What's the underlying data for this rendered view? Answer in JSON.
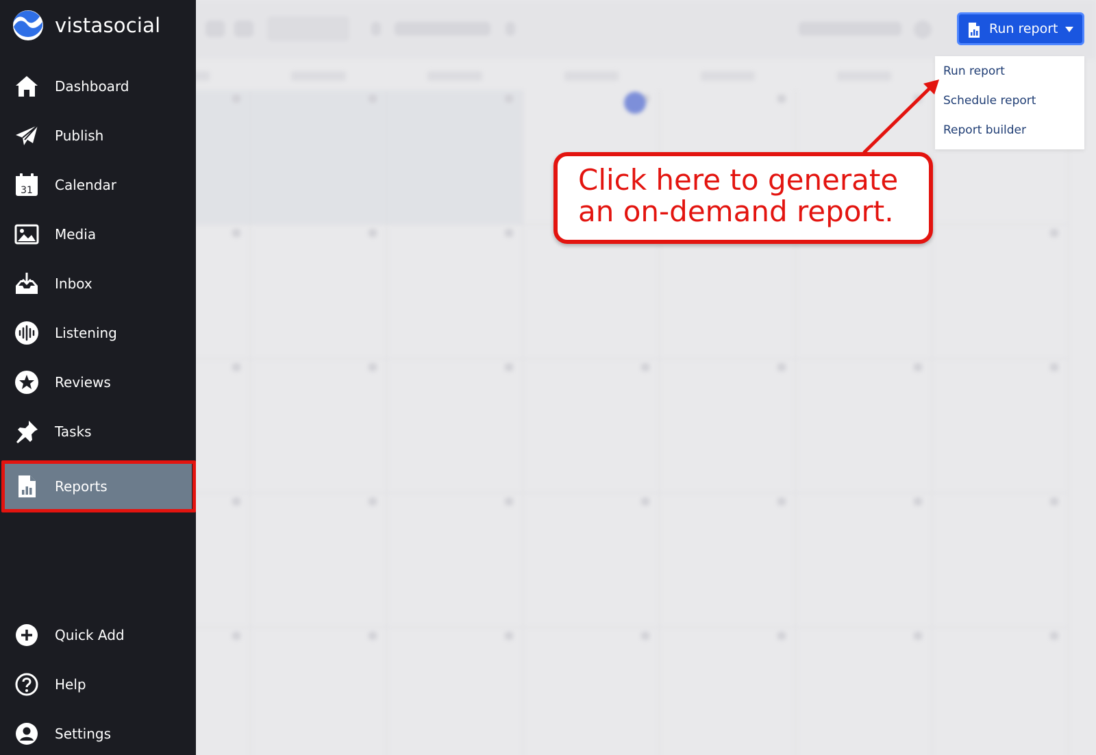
{
  "brand": {
    "name": "vistasocial"
  },
  "sidebar": {
    "items": [
      {
        "label": "Dashboard",
        "icon": "house-icon"
      },
      {
        "label": "Publish",
        "icon": "paper-plane-icon"
      },
      {
        "label": "Calendar",
        "icon": "calendar-icon",
        "badge": "31"
      },
      {
        "label": "Media",
        "icon": "image-icon"
      },
      {
        "label": "Inbox",
        "icon": "inbox-icon"
      },
      {
        "label": "Listening",
        "icon": "soundwave-icon"
      },
      {
        "label": "Reviews",
        "icon": "star-icon"
      },
      {
        "label": "Tasks",
        "icon": "pushpin-icon"
      },
      {
        "label": "Reports",
        "icon": "report-icon",
        "active": true
      }
    ],
    "bottom_items": [
      {
        "label": "Quick Add",
        "icon": "plus-circle-icon"
      },
      {
        "label": "Help",
        "icon": "question-circle-icon"
      },
      {
        "label": "Settings",
        "icon": "user-circle-icon"
      }
    ]
  },
  "toolbar": {
    "run_report_label": "Run report"
  },
  "run_report_menu": {
    "items": [
      "Run report",
      "Schedule report",
      "Report builder"
    ]
  },
  "annotation": {
    "line1": "Click here to generate",
    "line2": "an on-demand report."
  },
  "colors": {
    "sidebar_bg": "#1b1c22",
    "active_item_bg": "#6c7c8c",
    "annotation_red": "#e3140f",
    "primary_button": "#1a56e0",
    "menu_text": "#1f3d74"
  }
}
